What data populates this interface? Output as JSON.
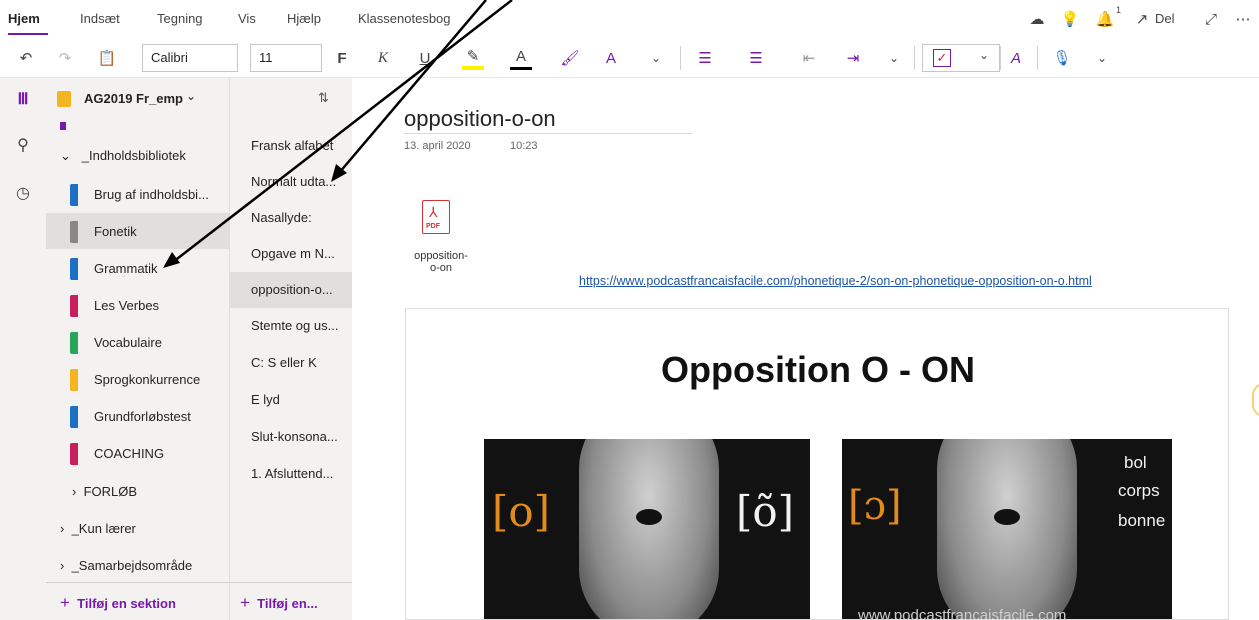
{
  "ribbon": {
    "tabs": [
      "Hjem",
      "Indsæt",
      "Tegning",
      "Vis",
      "Hjælp",
      "Klassenotesbog"
    ],
    "share_label": "Del",
    "font_name": "Calibri",
    "font_size": "11",
    "bold_label": "F",
    "italic_label": "K",
    "underline_label": "U",
    "notification_count": "1"
  },
  "notebook": {
    "name": "AG2019 Fr_emp",
    "groups": {
      "library": "_Indholdsbibliotek",
      "forlob": "FORLØB",
      "teacher": "_Kun lærer",
      "collab": "_Samarbejdsområde"
    },
    "sections": [
      {
        "label": "Brug af indholdsbi...",
        "color": "#1e6fc6"
      },
      {
        "label": "Fonetik",
        "color": "#8a8886"
      },
      {
        "label": "Grammatik",
        "color": "#1e6fc6"
      },
      {
        "label": "Les Verbes",
        "color": "#c8205c"
      },
      {
        "label": "Vocabulaire",
        "color": "#2aa55c"
      },
      {
        "label": "Sprogkonkurrence",
        "color": "#f3b521"
      },
      {
        "label": "Grundforløbstest",
        "color": "#1e6fc6"
      },
      {
        "label": "COACHING",
        "color": "#c8205c"
      }
    ],
    "add_section": "Tilføj en sektion"
  },
  "pages": {
    "items": [
      "Fransk alfabet",
      "Normalt udta...",
      "Nasallyde:",
      "Opgave m N...",
      "opposition-o...",
      "Stemte og us...",
      "C: S eller K",
      "E lyd",
      "Slut-konsona...",
      "1. Afsluttend..."
    ],
    "add_page": "Tilføj en..."
  },
  "page": {
    "title": "opposition-o-on",
    "date": "13. april 2020",
    "time": "10:23",
    "attachment_badge": "PDF",
    "attachment_name_1": "opposition-",
    "attachment_name_2": "o-on",
    "link": "https://www.podcastfrancaisfacile.com/phonetique-2/son-on-phonetique-opposition-on-o.html",
    "image_heading": "Opposition O - ON",
    "left_symbol_1": "[o]",
    "left_symbol_2": "[õ]",
    "right_symbol": "[ɔ]",
    "right_words": [
      "bol",
      "corps",
      "bonne"
    ],
    "watermark": "www.podcastfrancaisfacile.com"
  }
}
